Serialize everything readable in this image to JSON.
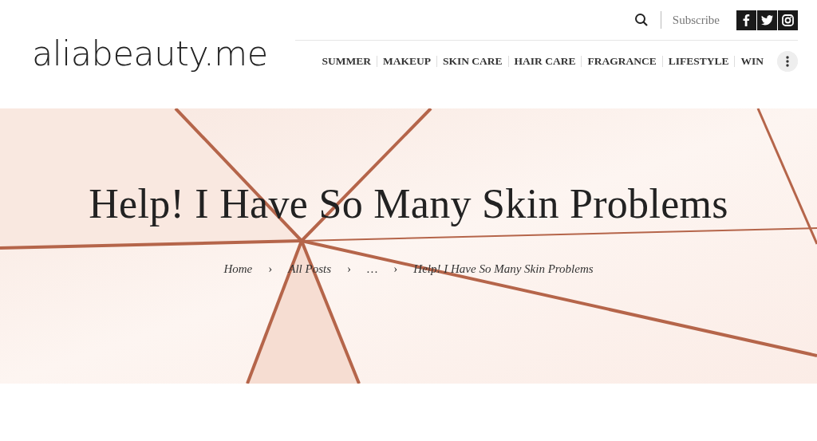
{
  "header": {
    "logo": "aliabeauty.me",
    "subscribe": "Subscribe",
    "nav": [
      {
        "label": "SUMMER"
      },
      {
        "label": "MAKEUP"
      },
      {
        "label": "SKIN CARE"
      },
      {
        "label": "HAIR CARE"
      },
      {
        "label": "FRAGRANCE"
      },
      {
        "label": "LIFESTYLE"
      },
      {
        "label": "WIN"
      }
    ]
  },
  "hero": {
    "kind": "picture",
    "title": "Help! I Have So Many Skin Problems",
    "breadcrumb": [
      {
        "kind": "link",
        "text": "Home"
      },
      {
        "kind": "separator",
        "text": "›"
      },
      {
        "kind": "link",
        "text": "All Posts"
      },
      {
        "kind": "separator",
        "text": "›"
      },
      {
        "kind": "text",
        "text": "…"
      },
      {
        "kind": "separator",
        "text": "›"
      },
      {
        "kind": "current",
        "text": "Help! I Have So Many Skin Problems"
      }
    ]
  }
}
